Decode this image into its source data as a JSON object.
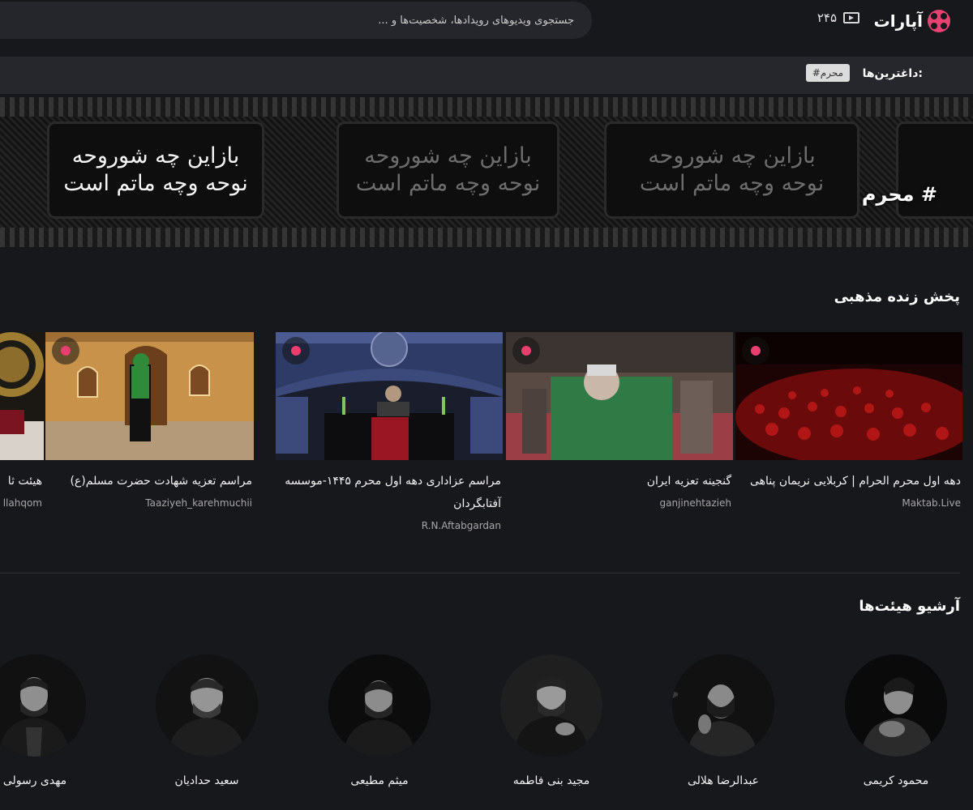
{
  "header": {
    "logo_text": "آپارات",
    "counter": "۲۴۵",
    "search_placeholder": "جستجوی ویدیوهای رویدادها، شخصیت‌ها و ..."
  },
  "tags": {
    "label": "داغترین‌ها:",
    "items": [
      "#محرم"
    ]
  },
  "banner": {
    "title": "# محرم",
    "calligraphy_line1": "بازاین چه شوروحه",
    "calligraphy_line2": "نوحه وچه ماتم است"
  },
  "live_section": {
    "title": "پخش زنده مذهبی",
    "videos": [
      {
        "title": "دهه اول محرم الحرام | کربلایی نریمان پناهی",
        "channel": "Maktab.Live"
      },
      {
        "title": "گنجینه تعزیه ایران",
        "channel": "ganjinehtazieh"
      },
      {
        "title": "مراسم عزاداری دهه اول محرم ۱۴۴۵-موسسه آفتابگردان",
        "channel": "R.N.Aftabgardan"
      },
      {
        "title": "مراسم تعزیه شهادت حضرت مسلم(ع)",
        "channel": "Taaziyeh_karehmuchii"
      },
      {
        "title": "هیئت ثا",
        "channel": "llahqom"
      }
    ]
  },
  "archive_section": {
    "title": "آرشیو هیئت‌ها",
    "people": [
      {
        "name": "محمود کریمی"
      },
      {
        "name": "عبدالرضا هلالی"
      },
      {
        "name": "مجید بنی فاطمه"
      },
      {
        "name": "میثم مطیعی"
      },
      {
        "name": "سعید حدادیان"
      },
      {
        "name": "مهدی رسولی"
      }
    ]
  },
  "colors": {
    "background": "#17181c",
    "accent": "#ea4173",
    "live_dot": "#ea3e6f"
  }
}
